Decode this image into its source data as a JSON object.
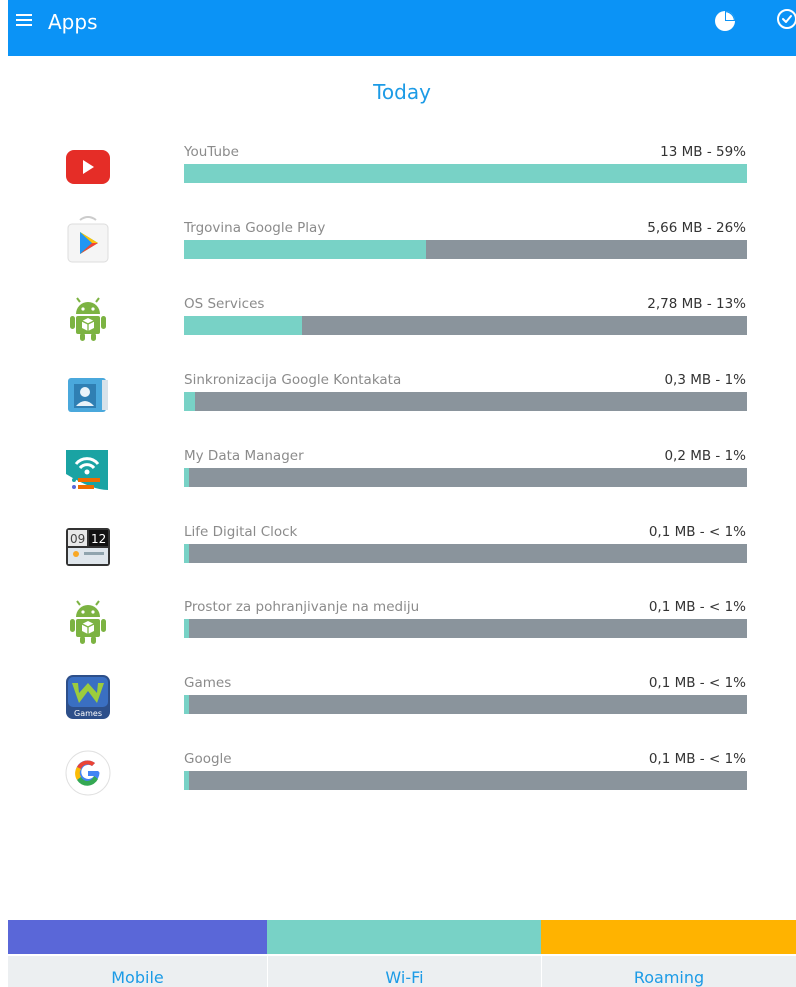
{
  "app_bar": {
    "title": "Apps",
    "menu_icon": "hamburger-menu-icon",
    "actions": [
      "pie-chart-icon",
      "clock-icon"
    ],
    "background_color": "#0b93f6"
  },
  "section_title": "Today",
  "apps": [
    {
      "name": "YouTube",
      "usage": "13 MB - 59%",
      "fraction": 1.0,
      "icon": "youtube-icon"
    },
    {
      "name": "Trgovina Google Play",
      "usage": "5,66 MB - 26%",
      "fraction": 0.43,
      "icon": "google-play-icon"
    },
    {
      "name": "OS Services",
      "usage": "2,78 MB - 13%",
      "fraction": 0.21,
      "icon": "android-icon"
    },
    {
      "name": "Sinkronizacija Google Kontakata",
      "usage": "0,3 MB - 1%",
      "fraction": 0.02,
      "icon": "contacts-icon"
    },
    {
      "name": "My Data Manager",
      "usage": "0,2 MB - 1%",
      "fraction": 0.008,
      "icon": "my-data-manager-icon"
    },
    {
      "name": "Life Digital Clock",
      "usage": "0,1 MB - < 1%",
      "fraction": 0.008,
      "icon": "digital-clock-icon"
    },
    {
      "name": "Prostor za pohranjivanje na mediju",
      "usage": "0,1 MB - < 1%",
      "fraction": 0.008,
      "icon": "android-icon"
    },
    {
      "name": "Games",
      "usage": "0,1 MB - < 1%",
      "fraction": 0.008,
      "icon": "games-icon"
    },
    {
      "name": "Google",
      "usage": "0,1 MB - < 1%",
      "fraction": 0.008,
      "icon": "google-icon"
    }
  ],
  "bottom_tabs": [
    {
      "label": "Mobile",
      "color": "#5a67d8"
    },
    {
      "label": "Wi-Fi",
      "color": "#78d2c6"
    },
    {
      "label": "Roaming",
      "color": "#ffb300"
    }
  ],
  "colors": {
    "accent": "#1c9be6",
    "bar_fill": "#78d2c6",
    "bar_track": "#8a949c"
  }
}
